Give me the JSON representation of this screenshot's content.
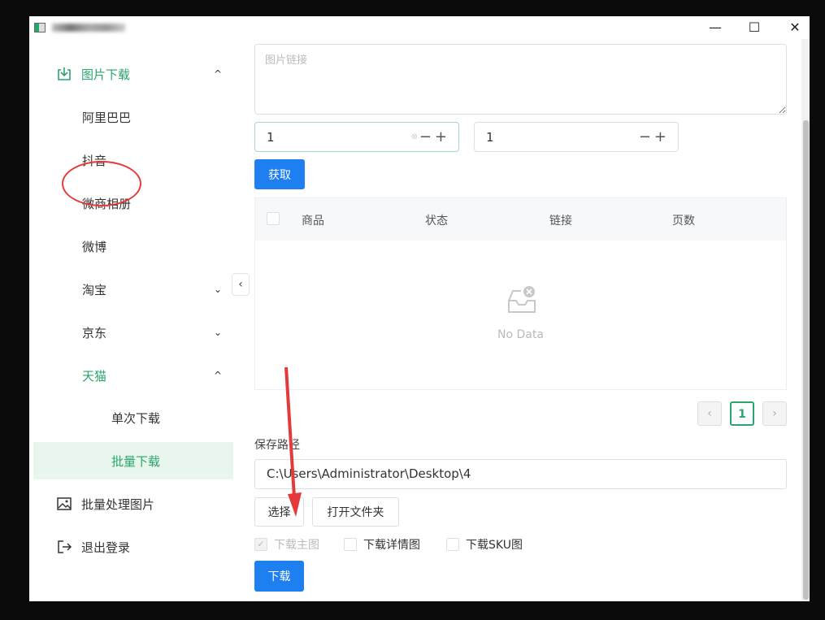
{
  "window": {
    "minimize": "—",
    "maximize": "☐",
    "close": "✕"
  },
  "sidebar": {
    "items": [
      {
        "label": "图片下载",
        "icon": "download-icon",
        "chevron": "^"
      },
      {
        "label": "阿里巴巴"
      },
      {
        "label": "抖音"
      },
      {
        "label": "微商相册"
      },
      {
        "label": "微博"
      },
      {
        "label": "淘宝",
        "chevron": "⌄"
      },
      {
        "label": "京东",
        "chevron": "⌄"
      },
      {
        "label": "天猫",
        "chevron": "^"
      },
      {
        "label": "单次下载"
      },
      {
        "label": "批量下载"
      },
      {
        "label": "批量处理图片",
        "icon": "image-icon"
      },
      {
        "label": "退出登录",
        "icon": "logout-icon"
      }
    ],
    "collapse": "‹"
  },
  "main": {
    "link_placeholder": "图片链接",
    "start_value": "1",
    "end_value": "1",
    "stepper": "−+",
    "fetch_label": "获取",
    "table": {
      "headers": [
        "商品",
        "状态",
        "链接",
        "页数"
      ],
      "empty_text": "No Data"
    },
    "pagination": {
      "prev": "‹",
      "page": "1",
      "next": "›"
    },
    "save_path_label": "保存路径",
    "save_path": "C:\\Users\\Administrator\\Desktop\\4",
    "choose_label": "选择",
    "open_folder_label": "打开文件夹",
    "options": [
      {
        "label": "下载主图",
        "checked": true,
        "disabled": true
      },
      {
        "label": "下载详情图",
        "checked": false
      },
      {
        "label": "下载SKU图",
        "checked": false
      }
    ],
    "download_label": "下载"
  },
  "colors": {
    "accent": "#2aa56b",
    "primary": "#1e7ff0",
    "annotation": "#e53a3a"
  }
}
